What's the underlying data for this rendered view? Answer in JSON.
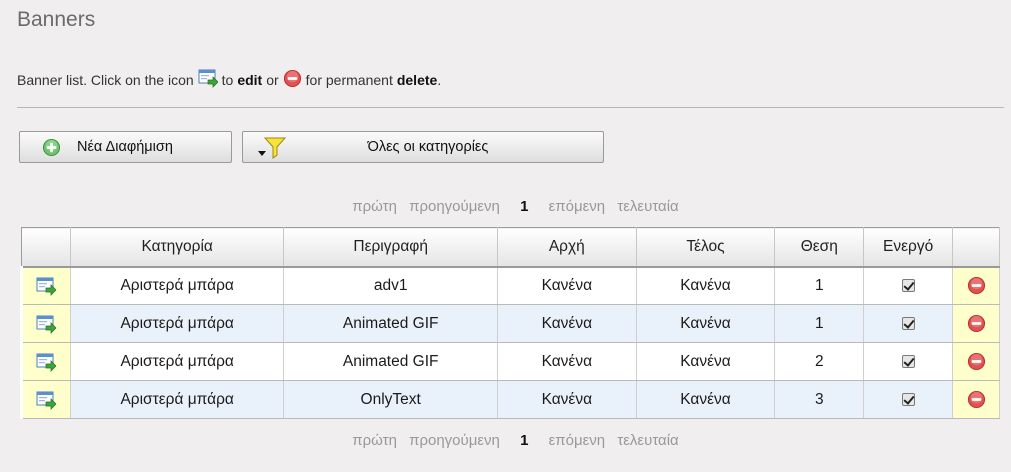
{
  "page": {
    "title": "Banners"
  },
  "intro": {
    "part1": "Banner list. Click on the icon",
    "part2": "to",
    "edit_word": "edit",
    "part3": "or",
    "part4": "for permanent",
    "delete_word": "delete",
    "part5": "."
  },
  "toolbar": {
    "new_label": "Νέα Διαφήμιση",
    "category_label": "Όλες οι κατηγορίες"
  },
  "pager": {
    "first": "πρώτη",
    "prev": "προηγούμενη",
    "current": "1",
    "next": "επόμενη",
    "last": "τελευταία"
  },
  "table": {
    "headers": [
      "",
      "Κατηγορία",
      "Περιγραφή",
      "Αρχή",
      "Τέλος",
      "Θεση",
      "Ενεργό",
      ""
    ],
    "rows": [
      {
        "category": "Αριστερά μπάρα",
        "description": "adv1",
        "start": "Κανένα",
        "end": "Κανένα",
        "position": "1",
        "active": true
      },
      {
        "category": "Αριστερά μπάρα",
        "description": "Animated GIF",
        "start": "Κανένα",
        "end": "Κανένα",
        "position": "1",
        "active": true
      },
      {
        "category": "Αριστερά μπάρα",
        "description": "Animated GIF",
        "start": "Κανένα",
        "end": "Κανένα",
        "position": "2",
        "active": true
      },
      {
        "category": "Αριστερά μπάρα",
        "description": "OnlyText",
        "start": "Κανένα",
        "end": "Κανένα",
        "position": "3",
        "active": true
      }
    ]
  },
  "icons": {
    "edit": "edit-icon",
    "delete": "delete-icon",
    "add": "add-icon",
    "filter": "filter-icon"
  },
  "colors": {
    "background": "#f0eeee",
    "row_alt": "#e9f1fb",
    "action_cell": "#ffffcc",
    "delete_red": "#e23b3b",
    "add_green": "#5cb85c"
  }
}
